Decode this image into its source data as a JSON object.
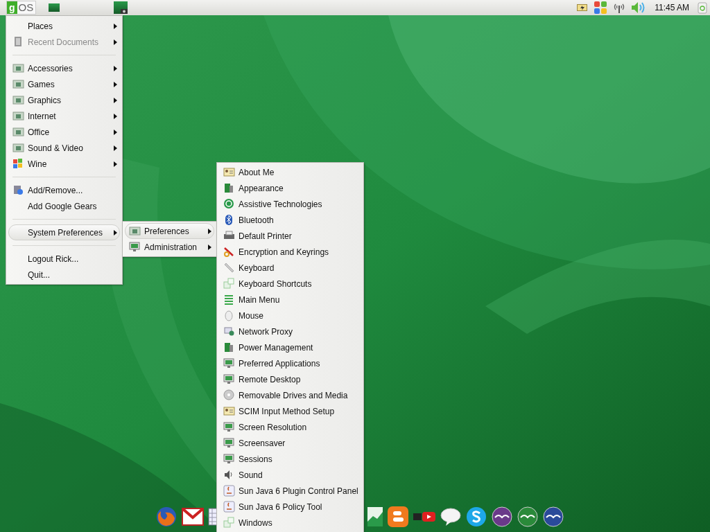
{
  "top_panel": {
    "logo": {
      "mark": "g",
      "text": "OS"
    },
    "clock": "11:45 AM"
  },
  "main_menu": [
    {
      "kind": "item",
      "label": "Places",
      "submenu": true,
      "disabled": false,
      "selected": false
    },
    {
      "kind": "item",
      "label": "Recent Documents",
      "submenu": true,
      "disabled": true,
      "selected": false
    },
    {
      "kind": "separator"
    },
    {
      "kind": "item",
      "label": "Accessories",
      "submenu": true,
      "disabled": false,
      "selected": false
    },
    {
      "kind": "item",
      "label": "Games",
      "submenu": true,
      "disabled": false,
      "selected": false
    },
    {
      "kind": "item",
      "label": "Graphics",
      "submenu": true,
      "disabled": false,
      "selected": false
    },
    {
      "kind": "item",
      "label": "Internet",
      "submenu": true,
      "disabled": false,
      "selected": false
    },
    {
      "kind": "item",
      "label": "Office",
      "submenu": true,
      "disabled": false,
      "selected": false
    },
    {
      "kind": "item",
      "label": "Sound & Video",
      "submenu": true,
      "disabled": false,
      "selected": false
    },
    {
      "kind": "item",
      "label": "Wine",
      "submenu": true,
      "disabled": false,
      "selected": false
    },
    {
      "kind": "separator"
    },
    {
      "kind": "item",
      "label": "Add/Remove...",
      "submenu": false,
      "disabled": false,
      "selected": false
    },
    {
      "kind": "item",
      "label": "Add Google Gears",
      "submenu": false,
      "disabled": false,
      "selected": false
    },
    {
      "kind": "separator"
    },
    {
      "kind": "item",
      "label": "System Preferences",
      "submenu": true,
      "disabled": false,
      "selected": true
    },
    {
      "kind": "separator"
    },
    {
      "kind": "item",
      "label": "Logout Rick...",
      "submenu": false,
      "disabled": false,
      "selected": false
    },
    {
      "kind": "item",
      "label": "Quit...",
      "submenu": false,
      "disabled": false,
      "selected": false
    }
  ],
  "system_preferences_menu": [
    {
      "kind": "item",
      "label": "Preferences",
      "submenu": true,
      "disabled": false,
      "selected": true
    },
    {
      "kind": "item",
      "label": "Administration",
      "submenu": true,
      "disabled": false,
      "selected": false
    }
  ],
  "preferences_menu": [
    {
      "kind": "item",
      "label": "About Me",
      "submenu": false,
      "disabled": false,
      "selected": false
    },
    {
      "kind": "item",
      "label": "Appearance",
      "submenu": false,
      "disabled": false,
      "selected": false
    },
    {
      "kind": "item",
      "label": "Assistive Technologies",
      "submenu": false,
      "disabled": false,
      "selected": false
    },
    {
      "kind": "item",
      "label": "Bluetooth",
      "submenu": false,
      "disabled": false,
      "selected": false
    },
    {
      "kind": "item",
      "label": "Default Printer",
      "submenu": false,
      "disabled": false,
      "selected": false
    },
    {
      "kind": "item",
      "label": "Encryption and Keyrings",
      "submenu": false,
      "disabled": false,
      "selected": false
    },
    {
      "kind": "item",
      "label": "Keyboard",
      "submenu": false,
      "disabled": false,
      "selected": false
    },
    {
      "kind": "item",
      "label": "Keyboard Shortcuts",
      "submenu": false,
      "disabled": false,
      "selected": false
    },
    {
      "kind": "item",
      "label": "Main Menu",
      "submenu": false,
      "disabled": false,
      "selected": false
    },
    {
      "kind": "item",
      "label": "Mouse",
      "submenu": false,
      "disabled": false,
      "selected": false
    },
    {
      "kind": "item",
      "label": "Network Proxy",
      "submenu": false,
      "disabled": false,
      "selected": false
    },
    {
      "kind": "item",
      "label": "Power Management",
      "submenu": false,
      "disabled": false,
      "selected": false
    },
    {
      "kind": "item",
      "label": "Preferred Applications",
      "submenu": false,
      "disabled": false,
      "selected": false
    },
    {
      "kind": "item",
      "label": "Remote Desktop",
      "submenu": false,
      "disabled": false,
      "selected": false
    },
    {
      "kind": "item",
      "label": "Removable Drives and Media",
      "submenu": false,
      "disabled": false,
      "selected": false
    },
    {
      "kind": "item",
      "label": "SCIM Input Method Setup",
      "submenu": false,
      "disabled": false,
      "selected": false
    },
    {
      "kind": "item",
      "label": "Screen Resolution",
      "submenu": false,
      "disabled": false,
      "selected": false
    },
    {
      "kind": "item",
      "label": "Screensaver",
      "submenu": false,
      "disabled": false,
      "selected": false
    },
    {
      "kind": "item",
      "label": "Sessions",
      "submenu": false,
      "disabled": false,
      "selected": false
    },
    {
      "kind": "item",
      "label": "Sound",
      "submenu": false,
      "disabled": false,
      "selected": false
    },
    {
      "kind": "item",
      "label": "Sun Java 6 Plugin Control Panel",
      "submenu": false,
      "disabled": false,
      "selected": false
    },
    {
      "kind": "item",
      "label": "Sun Java 6 Policy Tool",
      "submenu": false,
      "disabled": false,
      "selected": false
    },
    {
      "kind": "item",
      "label": "Windows",
      "submenu": false,
      "disabled": false,
      "selected": false
    }
  ]
}
